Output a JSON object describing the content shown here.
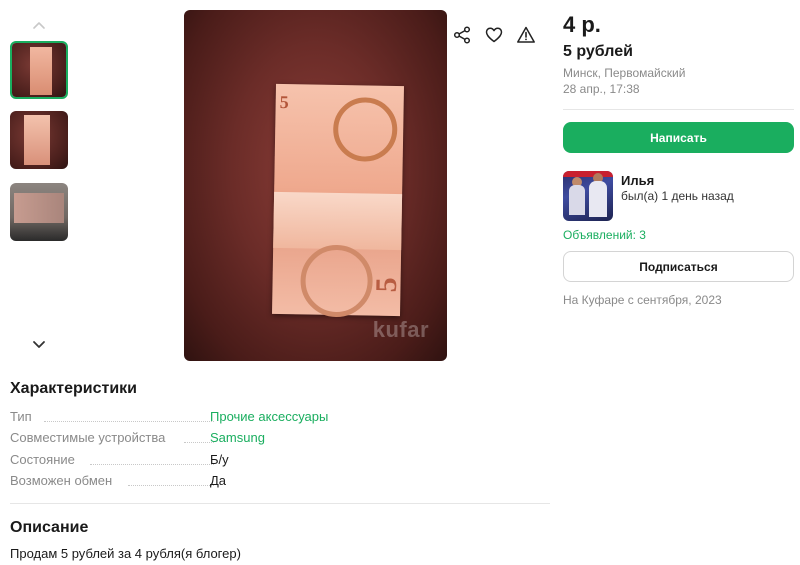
{
  "gallery": {
    "thumbnails": [
      "banknote-photo-1",
      "banknote-photo-2",
      "banknote-photo-3"
    ],
    "watermark": "kufar"
  },
  "actions": {
    "icons": [
      "share-icon",
      "heart-icon",
      "warning-icon"
    ]
  },
  "listing": {
    "price": "4 р.",
    "title": "5 рублей",
    "location": "Минск, Первомайский",
    "date": "28 апр., 17:38"
  },
  "contact": {
    "write_label": "Написать"
  },
  "seller": {
    "name": "Илья",
    "status": "был(а) 1 день назад",
    "ads": "Объявлений: 3",
    "subscribe_label": "Подписаться",
    "since": "На Куфаре с сентября, 2023"
  },
  "characteristics": {
    "heading": "Характеристики",
    "rows": [
      {
        "key": "Тип",
        "value": "Прочие аксессуары",
        "link": true
      },
      {
        "key": "Совместимые устройства",
        "value": "Samsung",
        "link": true
      },
      {
        "key": "Состояние",
        "value": "Б/у",
        "link": false
      },
      {
        "key": "Возможен обмен",
        "value": "Да",
        "link": false
      }
    ]
  },
  "description": {
    "heading": "Описание",
    "text": "Продам 5 рублей за 4 рубля(я блогер)"
  },
  "colors": {
    "accent": "#1aae5f",
    "muted": "#8a8a8a"
  }
}
